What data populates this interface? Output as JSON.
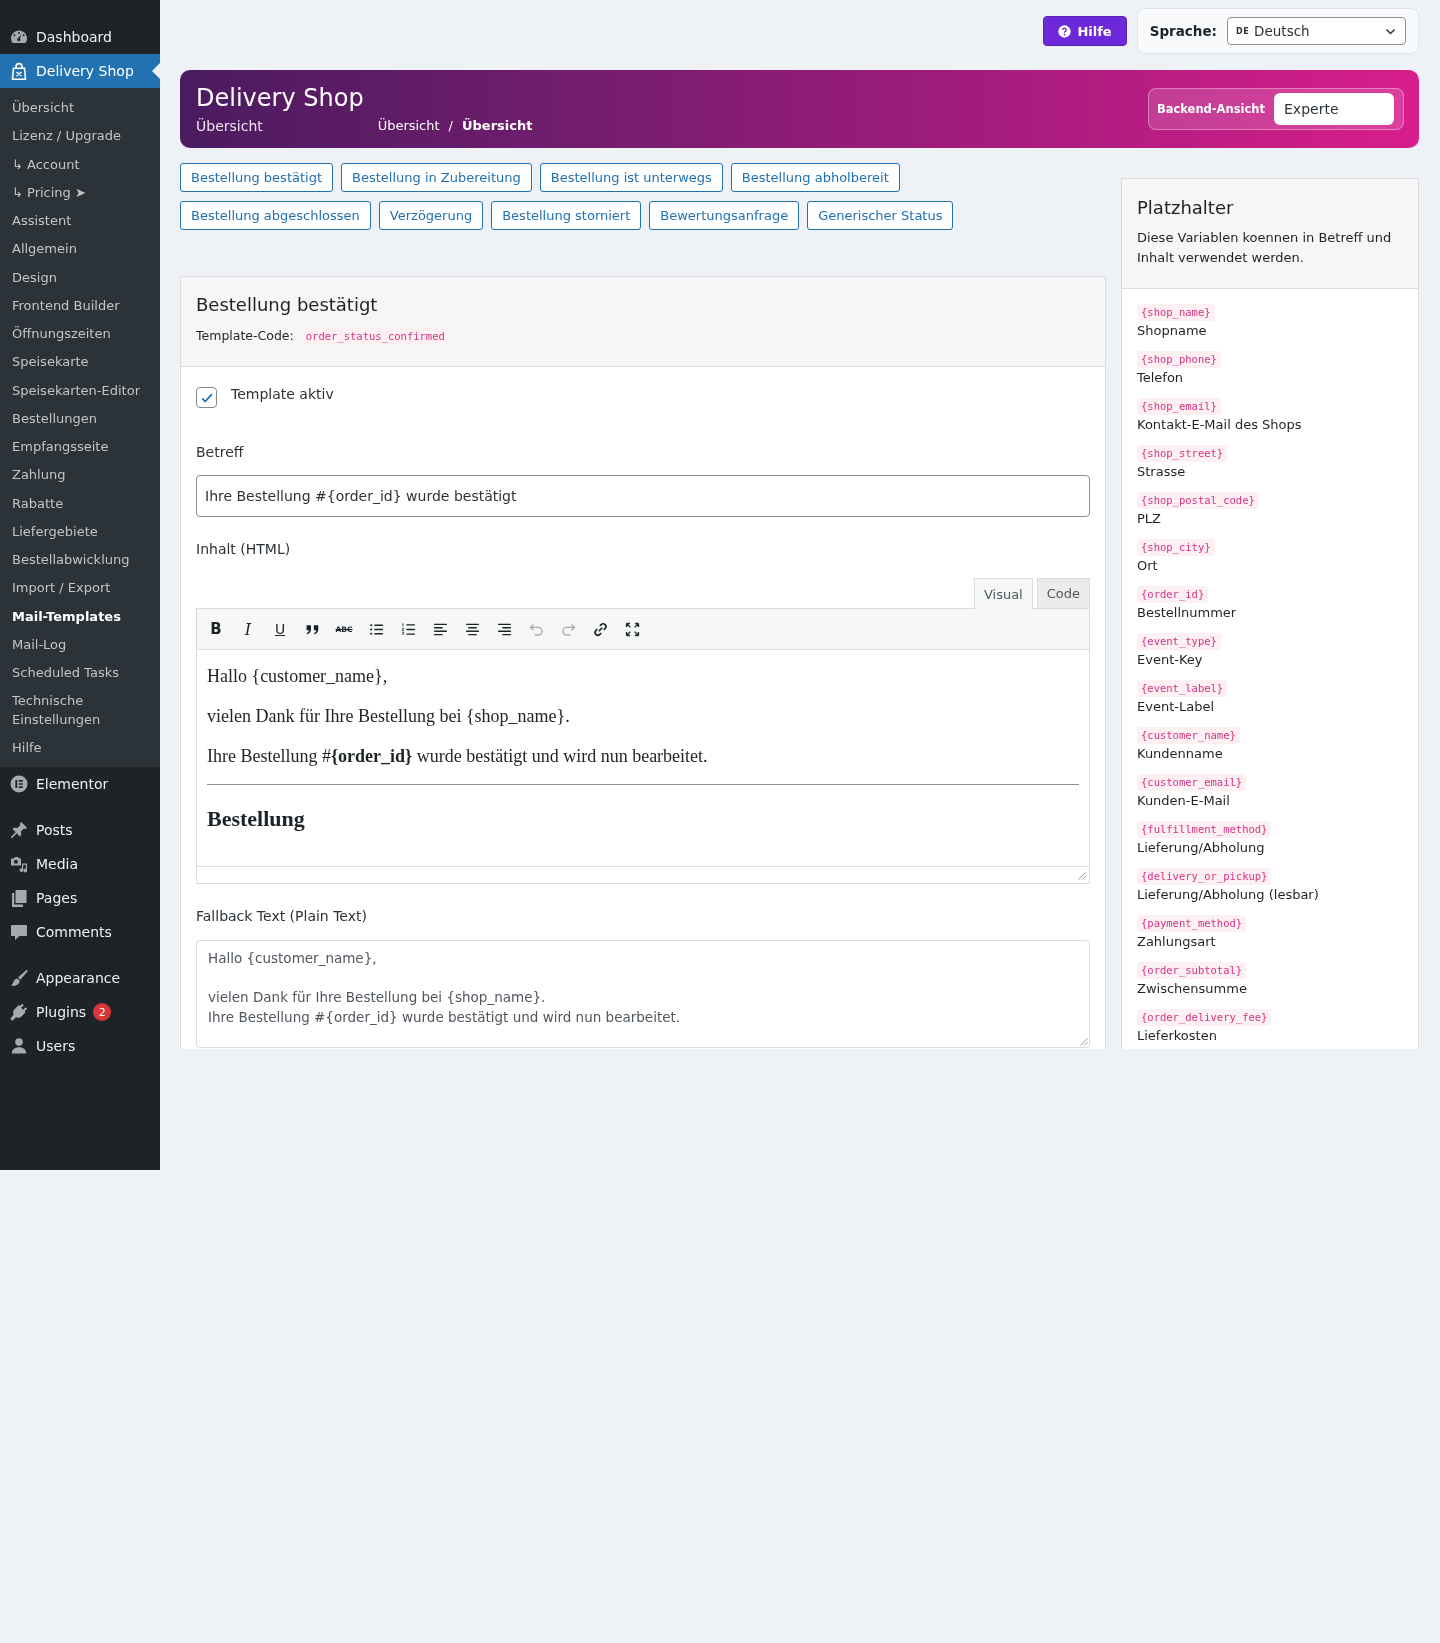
{
  "sidebar": {
    "groups": [
      [
        {
          "label": "Dashboard",
          "selected": false
        },
        {
          "label": "Delivery Shop",
          "selected": true,
          "submenu": [
            {
              "label": "Übersicht",
              "selected": false
            },
            {
              "label": "Lizenz / Upgrade",
              "selected": false
            },
            {
              "label": "↳ Account",
              "selected": false
            },
            {
              "label": "↳ Pricing ➤",
              "selected": false
            },
            {
              "label": "Assistent",
              "selected": false
            },
            {
              "label": "Allgemein",
              "selected": false
            },
            {
              "label": "Design",
              "selected": false
            },
            {
              "label": "Frontend Builder",
              "selected": false
            },
            {
              "label": "Öffnungszeiten",
              "selected": false
            },
            {
              "label": "Speisekarte",
              "selected": false
            },
            {
              "label": "Speisekarten-Editor",
              "selected": false
            },
            {
              "label": "Bestellungen",
              "selected": false
            },
            {
              "label": "Empfangsseite",
              "selected": false
            },
            {
              "label": "Zahlung",
              "selected": false
            },
            {
              "label": "Rabatte",
              "selected": false
            },
            {
              "label": "Liefergebiete",
              "selected": false
            },
            {
              "label": "Bestellabwicklung",
              "selected": false
            },
            {
              "label": "Import / Export",
              "selected": false
            },
            {
              "label": "Mail-Templates",
              "selected": true
            },
            {
              "label": "Mail-Log",
              "selected": false
            },
            {
              "label": "Scheduled Tasks",
              "selected": false
            },
            {
              "label": "Technische Einstellungen",
              "selected": false
            },
            {
              "label": "Hilfe",
              "selected": false
            }
          ]
        },
        {
          "label": "Elementor",
          "selected": false
        }
      ],
      [
        {
          "label": "Posts",
          "selected": false
        },
        {
          "label": "Media",
          "selected": false
        },
        {
          "label": "Pages",
          "selected": false
        },
        {
          "label": "Comments",
          "selected": false
        }
      ],
      [
        {
          "label": "Appearance",
          "selected": false
        },
        {
          "label": "Plugins",
          "selected": false,
          "badge": "2"
        },
        {
          "label": "Users",
          "selected": false
        }
      ]
    ]
  },
  "topbar": {
    "help_button": "Hilfe",
    "language": {
      "label": "Sprache:",
      "flag": "DE",
      "value": "Deutsch"
    }
  },
  "header": {
    "title": "Delivery Shop",
    "subtitle": "Übersicht",
    "breadcrumb": {
      "separator": "/",
      "items": [
        {
          "label": "Übersicht",
          "current": false
        },
        {
          "label": "Übersicht",
          "current": true
        }
      ]
    },
    "view_mode": {
      "label": "Backend-Ansicht",
      "value": "Experte"
    }
  },
  "template_buttons": [
    "Bestellung bestätigt",
    "Bestellung in Zubereitung",
    "Bestellung ist unterwegs",
    "Bestellung abholbereit",
    "Bestellung abgeschlossen",
    "Verzögerung",
    "Bestellung storniert",
    "Bewertungsanfrage",
    "Generischer Status"
  ],
  "template_card": {
    "title": "Bestellung bestätigt",
    "code_label": "Template-Code:",
    "code": "order_status_confirmed",
    "active_label": "Template aktiv",
    "active": true,
    "subject_label": "Betreff",
    "subject": "Ihre Bestellung #{order_id} wurde bestätigt",
    "content_label": "Inhalt (HTML)",
    "editor_tabs": [
      {
        "label": "Visual",
        "selected": true
      },
      {
        "label": "Code",
        "selected": false
      }
    ],
    "toolbar": [
      {
        "kind": "bold",
        "glyph": "B",
        "disabled": false
      },
      {
        "kind": "italic",
        "glyph": "I",
        "disabled": false
      },
      {
        "kind": "underline",
        "glyph": "U",
        "disabled": false
      },
      {
        "kind": "blockquote",
        "disabled": false
      },
      {
        "kind": "strikethrough",
        "glyph": "ABC",
        "disabled": false
      },
      {
        "kind": "bullet-list",
        "disabled": false
      },
      {
        "kind": "numbered-list",
        "disabled": false
      },
      {
        "kind": "align-left",
        "disabled": false
      },
      {
        "kind": "align-center",
        "disabled": false
      },
      {
        "kind": "align-right",
        "disabled": false
      },
      {
        "kind": "undo",
        "disabled": true
      },
      {
        "kind": "redo",
        "disabled": true
      },
      {
        "kind": "link",
        "disabled": false
      },
      {
        "kind": "fullscreen",
        "disabled": false
      }
    ],
    "content": [
      {
        "kind": "paragraph",
        "text": "Hallo {customer_name},"
      },
      {
        "kind": "paragraph",
        "text": "vielen Dank für Ihre Bestellung bei {shop_name}."
      },
      {
        "kind": "paragraph",
        "text": "Ihre Bestellung #**{order_id}** wurde bestätigt und wird nun bearbeitet."
      },
      {
        "kind": "rule"
      },
      {
        "kind": "heading",
        "text": "Bestellung"
      }
    ],
    "fallback_label": "Fallback Text (Plain Text)",
    "fallback_text": "Hallo {customer_name},\n\nvielen Dank für Ihre Bestellung bei {shop_name}.\nIhre Bestellung #{order_id} wurde bestätigt und wird nun bearbeitet."
  },
  "placeholder_panel": {
    "title": "Platzhalter",
    "description": "Diese Variablen koennen in Betreff und Inhalt verwendet werden.",
    "items": [
      {
        "code": "{shop_name}",
        "label": "Shopname"
      },
      {
        "code": "{shop_phone}",
        "label": "Telefon"
      },
      {
        "code": "{shop_email}",
        "label": "Kontakt-E-Mail des Shops"
      },
      {
        "code": "{shop_street}",
        "label": "Strasse"
      },
      {
        "code": "{shop_postal_code}",
        "label": "PLZ"
      },
      {
        "code": "{shop_city}",
        "label": "Ort"
      },
      {
        "code": "{order_id}",
        "label": "Bestellnummer"
      },
      {
        "code": "{event_type}",
        "label": "Event-Key"
      },
      {
        "code": "{event_label}",
        "label": "Event-Label"
      },
      {
        "code": "{customer_name}",
        "label": "Kundenname"
      },
      {
        "code": "{customer_email}",
        "label": "Kunden-E-Mail"
      },
      {
        "code": "{fulfillment_method}",
        "label": "Lieferung/Abholung"
      },
      {
        "code": "{delivery_or_pickup}",
        "label": "Lieferung/Abholung (lesbar)"
      },
      {
        "code": "{payment_method}",
        "label": "Zahlungsart"
      },
      {
        "code": "{order_subtotal}",
        "label": "Zwischensumme"
      },
      {
        "code": "{order_delivery_fee}",
        "label": "Lieferkosten"
      }
    ]
  }
}
